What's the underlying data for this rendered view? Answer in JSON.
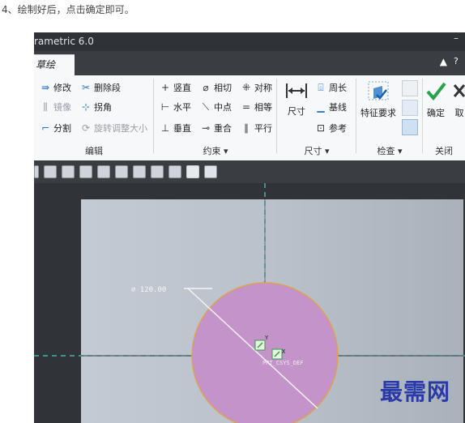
{
  "caption": "4、绘制好后，点击确定即可。",
  "window": {
    "title": "rametric 6.0"
  },
  "tabs": {
    "active_label": "草绘",
    "collapse_glyph": "▲",
    "help_glyph": "?"
  },
  "ribbon": {
    "edit": {
      "label": "编辑",
      "modify": "修改",
      "delete_segment": "删除段",
      "mirror": "镜像",
      "corner": "拐角",
      "divide": "分割",
      "rotate_resize": "旋转调整大小"
    },
    "constraint": {
      "label": "约束 ▾",
      "vertical": "竖直",
      "tangent": "相切",
      "symmetric": "对称",
      "horizontal": "水平",
      "midpoint": "中点",
      "equal": "相等",
      "perpendicular": "垂直",
      "coincident": "重合",
      "parallel": "平行"
    },
    "dimension": {
      "label": "尺寸 ▾",
      "dimension": "尺寸",
      "perimeter": "周长",
      "baseline": "基线",
      "reference": "参考"
    },
    "inspect": {
      "label": "检查 ▾",
      "feature_requirements": "特征要求"
    },
    "close": {
      "label": "关闭",
      "ok": "确定",
      "cancel_partial": "取"
    }
  },
  "sketch": {
    "diameter_label": "⌀ 120.00",
    "csys_label": "PRT_CSYS_DEF",
    "y_axis_label": "Y",
    "x_axis_label": "X"
  },
  "watermark": "最需网",
  "colors": {
    "circle_fill": "#c493c9",
    "circle_stroke": "#e0a050",
    "centerline": "#3fb6a6",
    "accent_green": "#2aa14a",
    "dimension_line": "#f3f3f3"
  },
  "icons": [
    "modify-icon",
    "delete-segment-icon",
    "mirror-icon",
    "corner-icon",
    "divide-icon",
    "rotate-resize-icon",
    "vertical-icon",
    "tangent-icon",
    "symmetric-icon",
    "horizontal-icon",
    "midpoint-icon",
    "equal-icon",
    "perpendicular-icon",
    "coincident-icon",
    "parallel-icon",
    "dimension-icon",
    "perimeter-icon",
    "baseline-icon",
    "reference-icon",
    "feature-requirements-icon",
    "ok-checkmark-icon"
  ]
}
